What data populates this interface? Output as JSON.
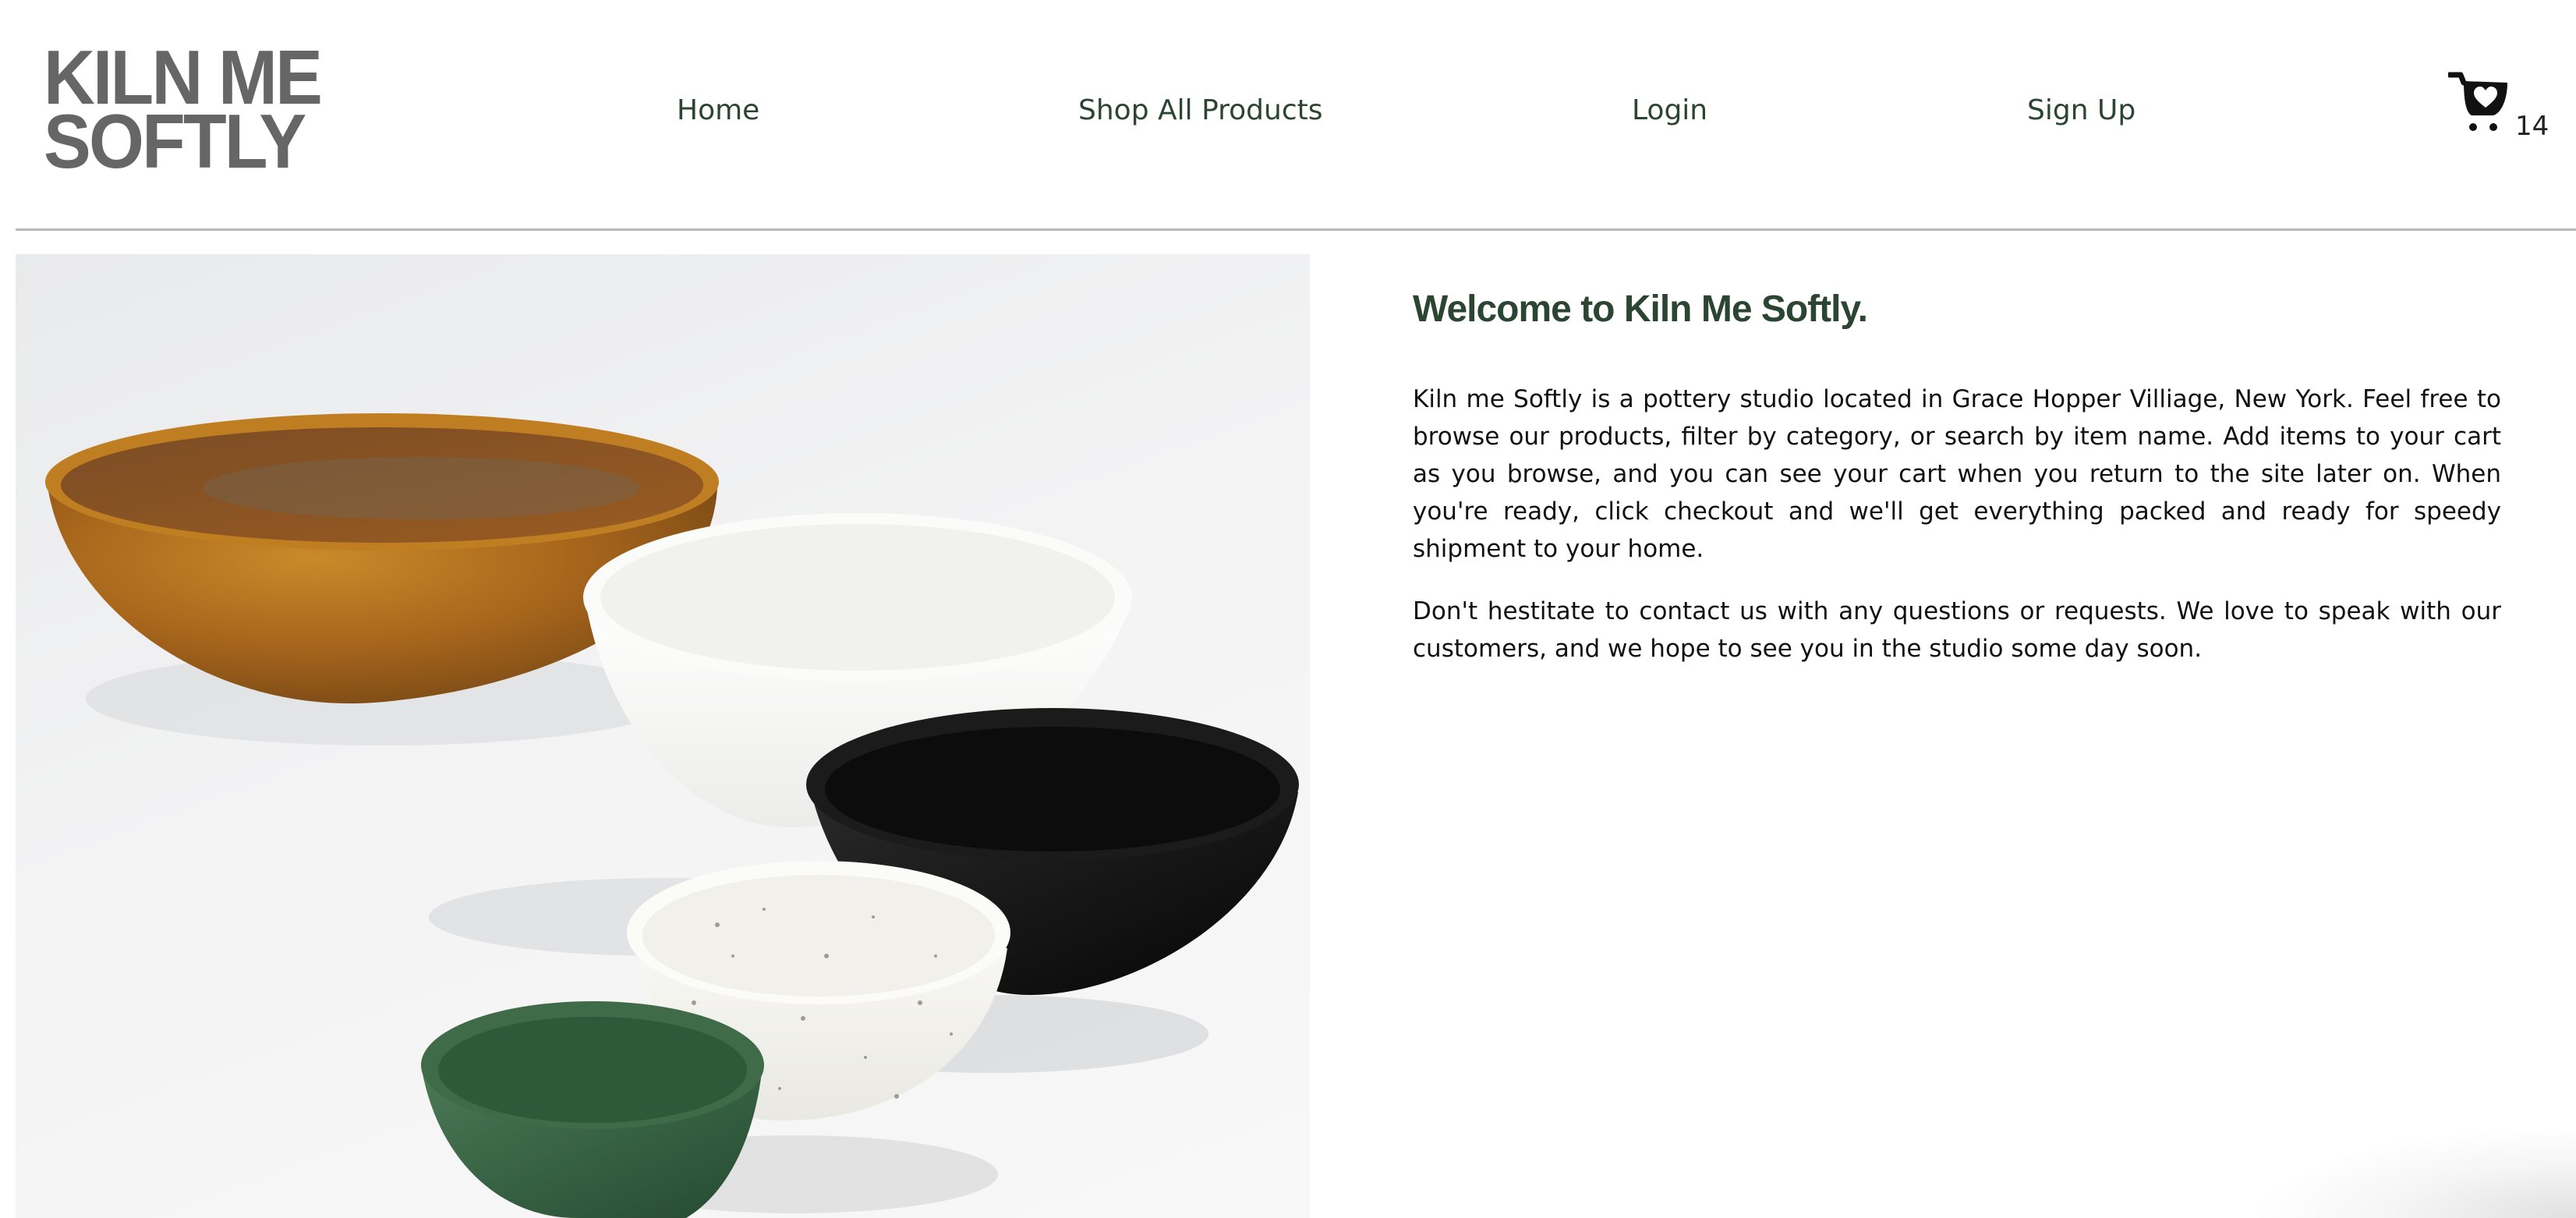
{
  "brand": {
    "logo_line1": "KILN ME",
    "logo_line2": "SOFTLY"
  },
  "nav": {
    "home": "Home",
    "shop": "Shop All Products",
    "login": "Login",
    "signup": "Sign Up"
  },
  "cart": {
    "count": "14",
    "icon": "cart-heart-icon"
  },
  "hero": {
    "icon": "bowls-photo"
  },
  "main": {
    "title": "Welcome to Kiln Me Softly.",
    "paragraph1": "Kiln me Softly is a pottery studio located in Grace Hopper Villiage, New York. Feel free to browse our products, filter by category, or search by item name. Add items to your cart as you browse, and you can see your cart when you return to the site later on. When you're ready, click checkout and we'll get everything packed and ready for speedy shipment to your home.",
    "paragraph2": "Don't hestitate to contact us with any questions or requests. We love to speak with our customers, and we hope to see you in the studio some day soon."
  },
  "colors": {
    "brand_green": "#2b4532",
    "logo_gray": "#666666",
    "divider": "#b8b8b8"
  }
}
